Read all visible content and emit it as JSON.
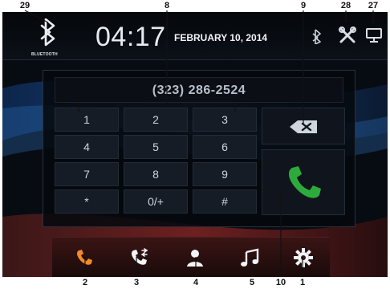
{
  "callouts": {
    "c29": "29",
    "c8": "8",
    "c9": "9",
    "c28": "28",
    "c27": "27",
    "c2": "2",
    "c3": "3",
    "c4": "4",
    "c5": "5",
    "c10": "10",
    "c1": "1"
  },
  "status_bar": {
    "bluetooth_label": "BLUETOOTH",
    "time": "04:17",
    "date": "FEBRUARY 10, 2014",
    "icons": [
      "bluetooth-icon",
      "tools-icon",
      "display-icon"
    ]
  },
  "dialer": {
    "number": "(323) 286-2524",
    "keys": [
      "1",
      "2",
      "3",
      "4",
      "5",
      "6",
      "7",
      "8",
      "9",
      "*",
      "0/+",
      "#"
    ],
    "delete_icon": "backspace-icon",
    "call_icon": "phone-icon",
    "call_color": "#2eaa3c"
  },
  "dock": {
    "items": [
      "phone-icon",
      "recent-calls-icon",
      "contacts-icon",
      "music-icon",
      "settings-icon"
    ],
    "active_color": "#f08a2a"
  }
}
